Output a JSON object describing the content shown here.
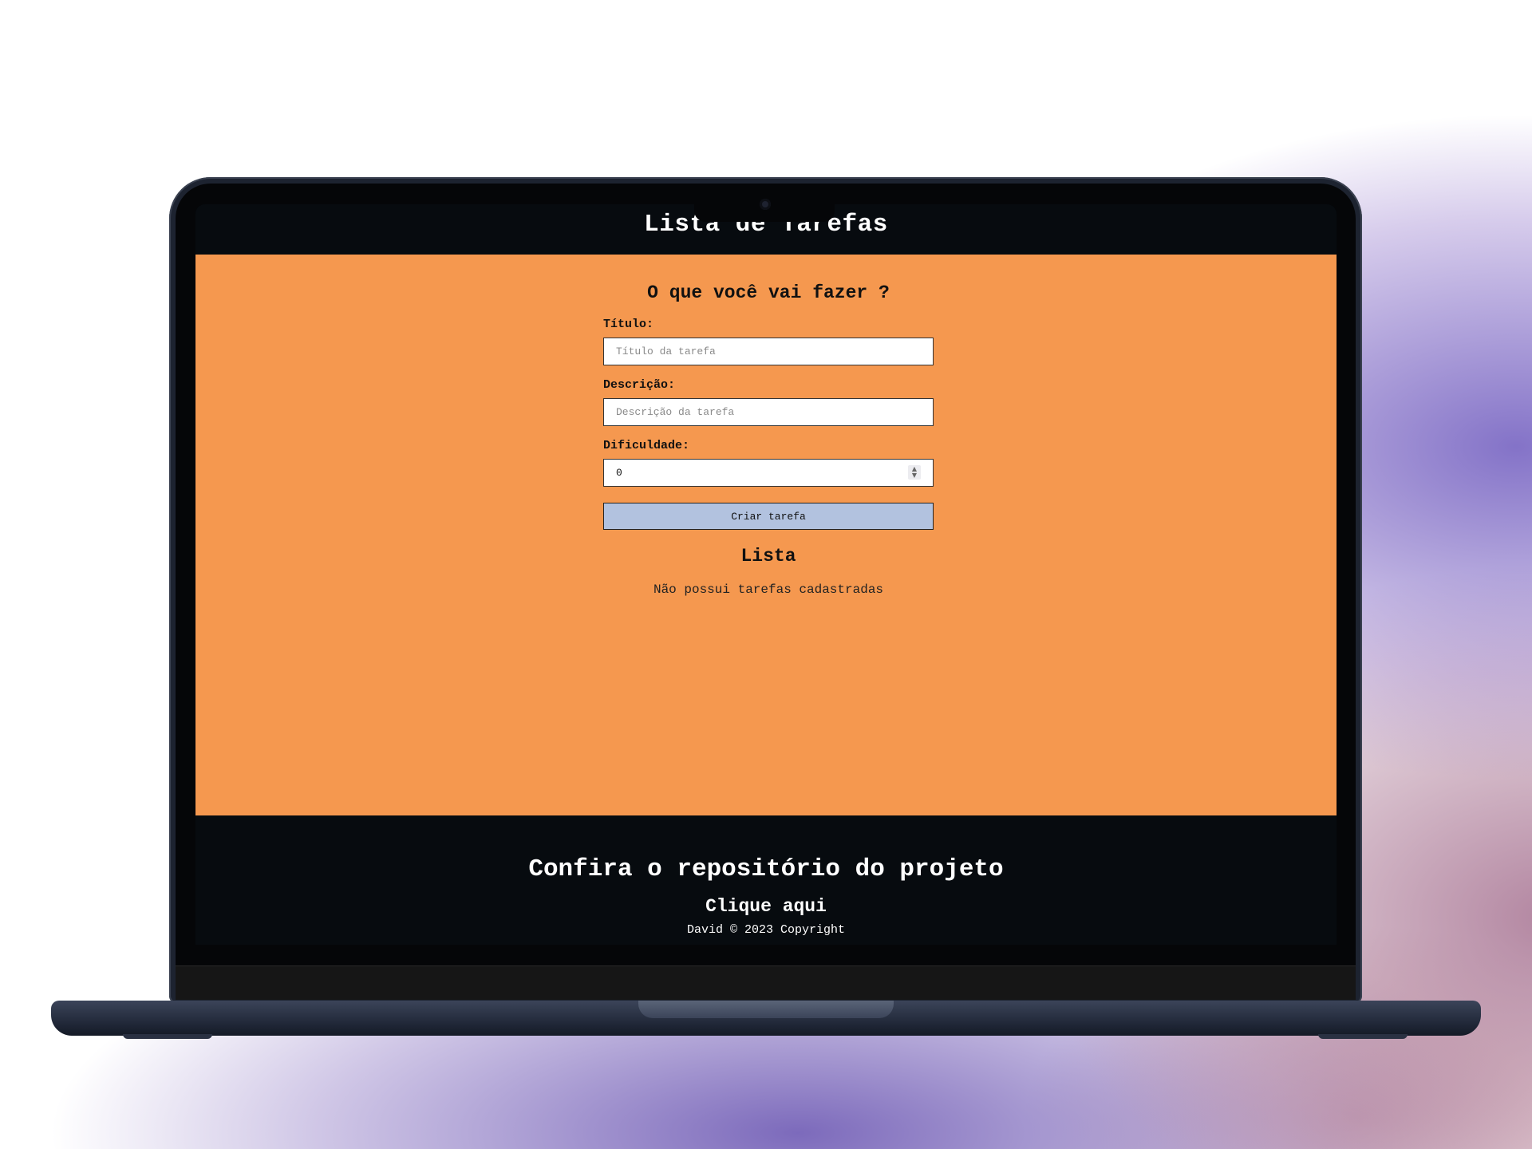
{
  "header": {
    "title": "Lista de Tarefas"
  },
  "form": {
    "heading": "O que você vai fazer ?",
    "title_label": "Título:",
    "title_placeholder": "Título da tarefa",
    "description_label": "Descrição:",
    "description_placeholder": "Descrição da tarefa",
    "difficulty_label": "Dificuldade:",
    "difficulty_value": "0",
    "submit_label": "Criar tarefa"
  },
  "list": {
    "heading": "Lista",
    "empty_message": "Não possui tarefas cadastradas"
  },
  "footer": {
    "repo_heading": "Confira o repositório do projeto",
    "repo_link": "Clique aqui",
    "copyright": "David © 2023 Copyright"
  },
  "colors": {
    "header_bg": "#070b0f",
    "main_bg": "#f5984f",
    "button_bg": "#b2c2df"
  }
}
